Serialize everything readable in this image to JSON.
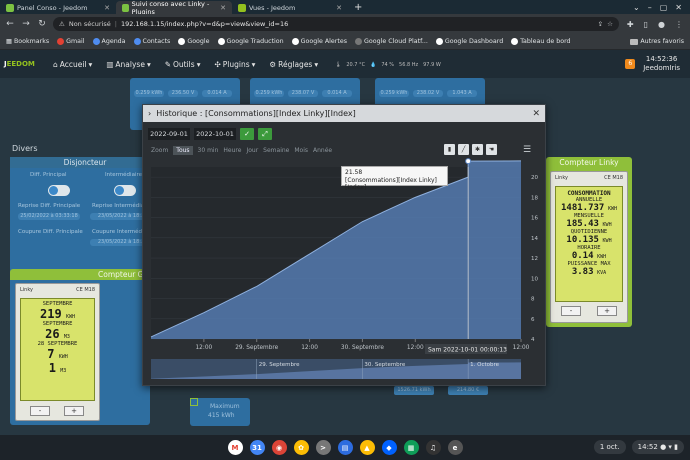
{
  "browser": {
    "tabs": [
      {
        "label": "Panel Conso - Jeedom",
        "active": false
      },
      {
        "label": "Suivi conso avec Linky - Plugins",
        "active": true
      },
      {
        "label": "Vues - Jeedom",
        "active": false
      }
    ],
    "security_label": "Non sécurisé",
    "url": "192.168.1.15/index.php?v=d&p=view&view_id=16",
    "bookmarks": [
      "Bookmarks",
      "Gmail",
      "Agenda",
      "Contacts",
      "Google",
      "Google Traduction",
      "Google Alertes",
      "Google Cloud Platf...",
      "Google Dashboard",
      "Tableau de bord"
    ],
    "other_favorites": "Autres favoris"
  },
  "jeedom": {
    "logo_left": "J",
    "logo_right": "EEDOM",
    "menus": [
      "Accueil",
      "Analyse",
      "Outils",
      "Plugins",
      "Réglages"
    ],
    "notif_count": "6",
    "time": "14:52:36",
    "user": "JeedomIris",
    "status_items": [
      "20.7 °C",
      "74 %",
      "56.8 Hz",
      "97.9 W"
    ]
  },
  "dashboard": {
    "section_title": "Divers",
    "disj": {
      "title": "Disjoncteur",
      "diff_label": "Diff. Principal",
      "inter_label": "Intermédiaire",
      "reprise_diff": "Reprise Diff. Principale",
      "reprise_inter": "Reprise Intermédiaire",
      "coupure_diff": "Coupure Diff. Principale",
      "coupure_inter": "Coupure Intermédiaire",
      "date1": "25/02/2022 à 03:33:18",
      "date2": "23/05/2022 à 18:..",
      "date3": "23/05/2022 à 18:.."
    },
    "cpt_g": {
      "title": "Compteur G",
      "brand": "Linky",
      "cert": "CE M18",
      "lines": [
        {
          "value": "219",
          "unit": "KWH",
          "label": "SEPTEMBRE"
        },
        {
          "value": "26",
          "unit": "M3",
          "label": "SEPTEMBRE"
        },
        {
          "value": "7",
          "unit": "KWH",
          "label": "28 SEPTEMBRE"
        },
        {
          "value": "1",
          "unit": "M3",
          "label": ""
        }
      ],
      "minus": "-",
      "plus": "+"
    },
    "cpt_l": {
      "title": "Compteur Linky",
      "brand": "Linky",
      "cert": "CE M18",
      "rows": [
        {
          "label": "CONSOMMATION",
          "value": ""
        },
        {
          "label": "ANNUELLE",
          "value": "1481.737",
          "unit": "KWH"
        },
        {
          "label": "MENSUELLE",
          "value": "185.43",
          "unit": "KWH"
        },
        {
          "label": "QUOTIDIENNE",
          "value": "10.135",
          "unit": "KWH"
        },
        {
          "label": "HORAIRE",
          "value": "0.14",
          "unit": "KWH"
        },
        {
          "label": "PUISSANCE MAX",
          "value": "3.83",
          "unit": "KVA"
        }
      ],
      "minus": "-",
      "plus": "+"
    },
    "minimum_label": "Maximum",
    "minimum_value": "415 kWh",
    "bottom_vals": [
      "1526.71 kWh",
      "214.80 €"
    ],
    "top_vals": [
      "0.259 kWh",
      "236.50 V",
      "0.014 A",
      "0.259 kWh",
      "238.07 V",
      "0.014 A",
      "0.259 kWh",
      "238.02 V",
      "1.043 A"
    ]
  },
  "modal": {
    "title": "Historique : [Consommations][Index Linky][Index]",
    "date_start": "2022-09-01",
    "date_end": "2022-10-01",
    "zoom_label": "Zoom",
    "zoom_options": [
      "Tous",
      "30 min",
      "Heure",
      "Jour",
      "Semaine",
      "Mois",
      "Année"
    ],
    "zoom_active": "Tous",
    "tooltip_value": "21.58",
    "tooltip_series": "[Consommations][Index Linky][Index]",
    "crosshair_label": "Sam 2022-10-01 00:00:13"
  },
  "chart_data": {
    "type": "area",
    "series": [
      {
        "name": "[Consommations][Index Linky][Index]",
        "values": [
          4.2,
          6.6,
          9.2,
          12.4,
          15.6,
          18.0,
          20.0,
          21.58,
          21.6
        ]
      }
    ],
    "x": [
      "2022-09-28 00:00",
      "2022-09-28 12:00",
      "2022-09-29 00:00",
      "2022-09-29 12:00",
      "2022-09-30 00:00",
      "2022-09-30 12:00",
      "2022-10-01 00:00",
      "2022-10-01 00:00:13",
      "2022-10-01 12:00"
    ],
    "x_tick_labels": [
      "12:00",
      "29. Septembre",
      "12:00",
      "30. Septembre",
      "12:00",
      "12:00"
    ],
    "y_ticks": [
      4,
      6,
      8,
      10,
      12,
      14,
      16,
      18,
      20
    ],
    "ylim": [
      4,
      21
    ],
    "navigator_labels": [
      "29. Septembre",
      "30. Septembre",
      "1. Octobre"
    ],
    "color": "#5b85c2"
  },
  "shelf": {
    "date": "1 oct.",
    "time": "14:52"
  }
}
